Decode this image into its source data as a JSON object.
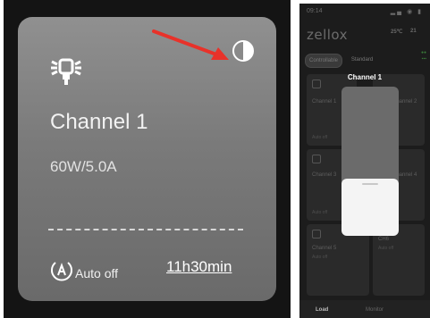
{
  "card": {
    "channel": "Channel 1",
    "power": "60W/5.0A",
    "auto_off_label": "Auto off",
    "timer": "11h30min",
    "icons": {
      "light": "light-bulb-icon",
      "contrast": "contrast-icon",
      "auto": "auto-mode-icon",
      "pointer": "red-arrow"
    },
    "colors": {
      "arrow": "#e8322a"
    }
  },
  "phone": {
    "status_time": "09:14",
    "logo": "zellox",
    "tabs": [
      "Controllable",
      "Standard"
    ],
    "overlay_title": "Channel 1",
    "slider_level": 0.4,
    "cards": [
      {
        "title": "Channel 1",
        "sub": "Auto off"
      },
      {
        "title": "Channel 2",
        "sub": ""
      },
      {
        "title": "Channel 3",
        "sub": "Auto off"
      },
      {
        "title": "Channel 4",
        "sub": ""
      },
      {
        "title": "Channel 5",
        "sub": "Auto off"
      },
      {
        "title": "CH6",
        "sub": "Auto off"
      }
    ],
    "nav": [
      "Load",
      "Monitor"
    ]
  }
}
